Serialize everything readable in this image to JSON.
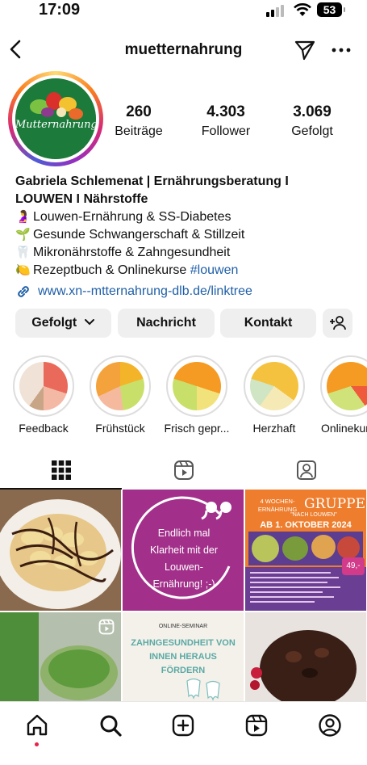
{
  "status_bar": {
    "time": "17:09",
    "battery": "53"
  },
  "header": {
    "username": "muetternahrung"
  },
  "profile": {
    "avatar_text": "Mutternahrung",
    "stats": [
      {
        "value": "260",
        "label": "Beiträge"
      },
      {
        "value": "4.303",
        "label": "Follower"
      },
      {
        "value": "3.069",
        "label": "Gefolgt"
      }
    ],
    "bio": {
      "name_line1": "Gabriela Schlemenat | Ernährungsberatung I",
      "name_line2": "LOUWEN I Nährstoffe",
      "lines": [
        {
          "emoji": "🤰",
          "text": "Louwen-Ernährung & SS-Diabetes"
        },
        {
          "emoji": "🌱",
          "text": "Gesunde Schwangerschaft & Stillzeit"
        },
        {
          "emoji": "🦷",
          "text": "Mikronährstoffe & Zahngesundheit"
        },
        {
          "emoji": "🍋",
          "text": "Rezeptbuch & Onlinekurse ",
          "hashtag": "#louwen"
        }
      ],
      "link": "www.xn--mtternahrung-dlb.de/linktree"
    }
  },
  "buttons": {
    "following": "Gefolgt",
    "message": "Nachricht",
    "contact": "Kontakt"
  },
  "highlights": [
    {
      "label": "Feedback"
    },
    {
      "label": "Frühstück"
    },
    {
      "label": "Frisch gepr..."
    },
    {
      "label": "Herzhaft"
    },
    {
      "label": "Onlinekurs"
    }
  ],
  "posts": {
    "post2_text": "Endlich mal Klarheit mit der Louwen-Ernährung! ;-)",
    "post3_title_a": "4 WOCHEN-ERNÄHRUNG",
    "post3_title_b": "GRUPPE",
    "post3_sub": "\"NACH LOUWEN\"",
    "post3_date": "AB 1. OKTOBER 2024",
    "post3_price": "49,-",
    "post5_small": "ONLINE-SEMINAR",
    "post5_title": "ZAHNGESUNDHEIT VON INNEN HERAUS FÖRDERN"
  },
  "colors": {
    "link": "#1f5fa8",
    "button_bg": "#efefef",
    "post_purple": "#a2308a",
    "post_orange": "#ee7d2d",
    "notification_dot": "#e5234b"
  }
}
